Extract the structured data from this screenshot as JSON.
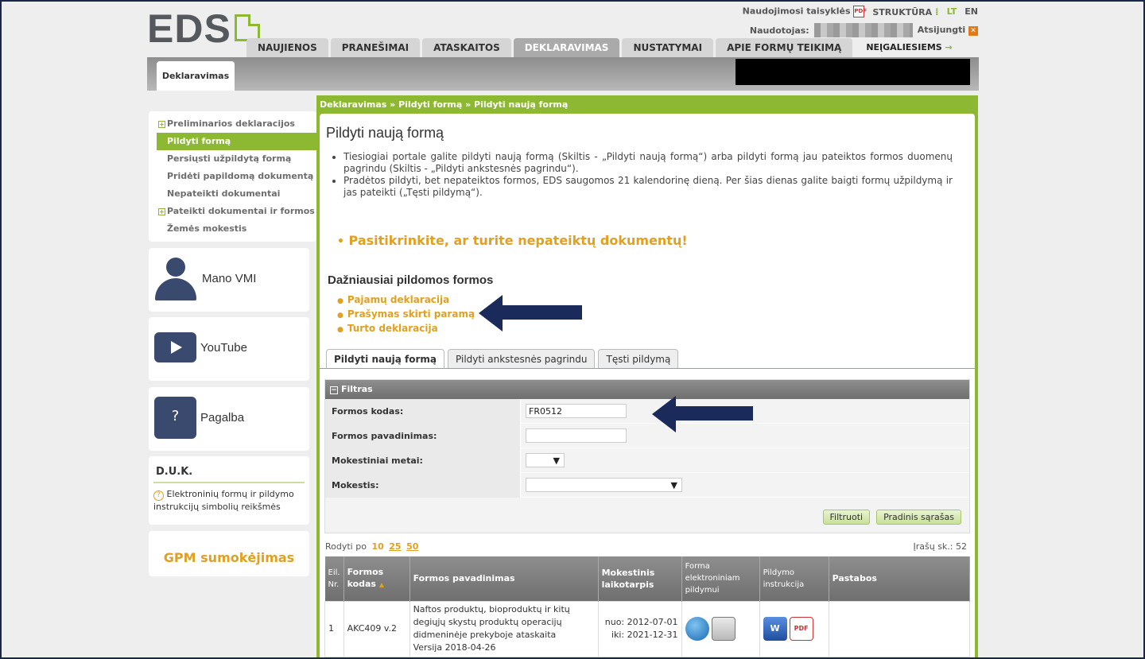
{
  "brand": {
    "logo_text": "EDS",
    "accent": "#8cb832",
    "orange": "#e0a020"
  },
  "toplinks": {
    "rules": "Naudojimosi taisyklės",
    "structure": "STRUKTŪRA",
    "lang_lt": "LT",
    "lang_en": "EN"
  },
  "user": {
    "label": "Naudotojas:",
    "logout": "Atsijungti"
  },
  "navtabs": [
    "NAUJIENOS",
    "PRANEŠIMAI",
    "ATASKAITOS",
    "DEKLARAVIMAS",
    "NUSTATYMAI",
    "APIE FORMŲ TEIKIMĄ"
  ],
  "nei": "NEĮGALIESIEMS",
  "subtab": "Deklaravimas",
  "leftmenu": [
    {
      "label": "Preliminarios deklaracijos",
      "plus": true
    },
    {
      "label": "Pildyti formą",
      "active": true
    },
    {
      "label": "Persiųsti užpildytą formą"
    },
    {
      "label": "Pridėti papildomą dokumentą"
    },
    {
      "label": "Nepateikti dokumentai"
    },
    {
      "label": "Pateikti dokumentai ir formos",
      "plus": true
    },
    {
      "label": "Žemės mokestis"
    }
  ],
  "sidebox": {
    "mano": "Mano VMI",
    "youtube": "YouTube",
    "help": "Pagalba"
  },
  "duk": {
    "title": "D.U.K.",
    "text": "Elektroninių formų ir pildymo instrukcijų simbolių reikšmės"
  },
  "gpm": "GPM sumokėjimas",
  "breadcrumb": "Deklaravimas » Pildyti formą » Pildyti naują formą",
  "page_title": "Pildyti naują formą",
  "intro": [
    "Tiesiogiai portale galite pildyti naują formą (Skiltis - „Pildyti naują formą“) arba pildyti formą jau pateiktos formos duomenų pagrindu (Skiltis - „Pildyti ankstesnės pagrindu“).",
    "Pradėtos pildyti, bet nepateiktos formos, EDS saugomos 21 kalendorinę dieną. Per šias dienas galite baigti formų užpildymą ir jas pateikti („Tęsti pildymą“)."
  ],
  "warning": "Pasitikrinkite, ar turite nepateiktų dokumentų!",
  "freq_title": "Dažniausiai pildomos formos",
  "freq": [
    "Pajamų deklaracija",
    "Prašymas skirti paramą",
    "Turto deklaracija"
  ],
  "tabs": [
    "Pildyti naują formą",
    "Pildyti ankstesnės pagrindu",
    "Tęsti pildymą"
  ],
  "filter": {
    "title": "Filtras",
    "code_label": "Formos kodas:",
    "code_value": "FR0512",
    "name_label": "Formos pavadinimas:",
    "year_label": "Mokestiniai metai:",
    "tax_label": "Mokestis:",
    "btn_filter": "Filtruoti",
    "btn_reset": "Pradinis sąrašas"
  },
  "pager": {
    "label": "Rodyti po",
    "opts": [
      "10",
      "25",
      "50"
    ],
    "count": "Įrašų sk.: 52"
  },
  "table": {
    "headers": [
      "Eil. Nr.",
      "Formos kodas",
      "Formos pavadinimas",
      "Mokestinis laikotarpis",
      "Forma elektroniniam pildymui",
      "Pildymo instrukcija",
      "Pastabos"
    ],
    "rows": [
      {
        "nr": "1",
        "code": "AKC409 v.2",
        "name": "Naftos produktų, bioproduktų ir kitų degiųjų skystų produktų operacijų didmeninėje prekyboje ataskaita",
        "version": "Versija 2018-04-26",
        "from": "nuo: 2012-07-01",
        "to": "iki: 2021-12-31"
      }
    ]
  }
}
